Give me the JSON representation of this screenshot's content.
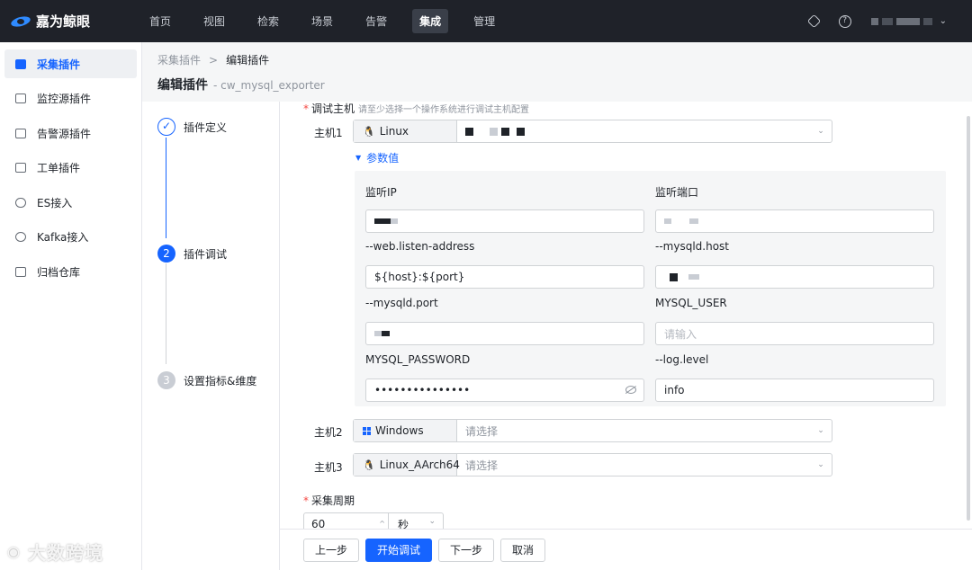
{
  "app": {
    "brand": "嘉为鲸眼"
  },
  "nav": {
    "items": [
      "首页",
      "视图",
      "检索",
      "场景",
      "告警",
      "集成",
      "管理"
    ],
    "active": "集成"
  },
  "sidebar": {
    "items": [
      {
        "label": "采集插件",
        "icon": "collect-plugin-icon",
        "active": true
      },
      {
        "label": "监控源插件",
        "icon": "monitor-source-icon",
        "active": false
      },
      {
        "label": "告警源插件",
        "icon": "alarm-source-icon",
        "active": false
      },
      {
        "label": "工单插件",
        "icon": "ticket-icon",
        "active": false
      },
      {
        "label": "ES接入",
        "icon": "cloud-icon",
        "active": false
      },
      {
        "label": "Kafka接入",
        "icon": "kafka-icon",
        "active": false
      },
      {
        "label": "归档仓库",
        "icon": "archive-icon",
        "active": false
      }
    ]
  },
  "breadcrumb": {
    "parent": "采集插件",
    "separator": ">",
    "current": "编辑插件"
  },
  "page": {
    "title": "编辑插件",
    "subtitle": "- cw_mysql_exporter"
  },
  "steps": [
    {
      "index": "✓",
      "label": "插件定义",
      "state": "done"
    },
    {
      "index": "2",
      "label": "插件调试",
      "state": "current"
    },
    {
      "index": "3",
      "label": "设置指标&维度",
      "state": "wait"
    }
  ],
  "form": {
    "debug_host_label": "调试主机",
    "debug_host_hint": "请至少选择一个操作系统进行调试主机配置",
    "hosts": [
      {
        "label": "主机1",
        "os": "Linux",
        "value": "",
        "placeholder": ""
      },
      {
        "label": "主机2",
        "os": "Windows",
        "value": "",
        "placeholder": "请选择"
      },
      {
        "label": "主机3",
        "os": "Linux_AArch64",
        "value": "",
        "placeholder": "请选择"
      }
    ],
    "params_toggle": "参数值",
    "params": [
      {
        "label": "监听IP",
        "value": "",
        "placeholder": ""
      },
      {
        "label": "监听端口",
        "value": "",
        "placeholder": ""
      },
      {
        "label": "--web.listen-address",
        "value": "${host}:${port}",
        "placeholder": ""
      },
      {
        "label": "--mysqld.host",
        "value": "",
        "placeholder": ""
      },
      {
        "label": "--mysqld.port",
        "value": "",
        "placeholder": ""
      },
      {
        "label": "MYSQL_USER",
        "value": "",
        "placeholder": "请输入"
      },
      {
        "label": "MYSQL_PASSWORD",
        "value": "•••••••••••••••",
        "placeholder": ""
      },
      {
        "label": "--log.level",
        "value": "info",
        "placeholder": ""
      }
    ],
    "period_label": "采集周期",
    "period_value": "60",
    "period_unit": "秒"
  },
  "footer": {
    "prev": "上一步",
    "start_debug": "开始调试",
    "next": "下一步",
    "cancel": "取消"
  },
  "watermark": "大数跨境",
  "colors": {
    "primary": "#1664ff",
    "topbar": "#1f2229",
    "required": "#f54a45"
  }
}
